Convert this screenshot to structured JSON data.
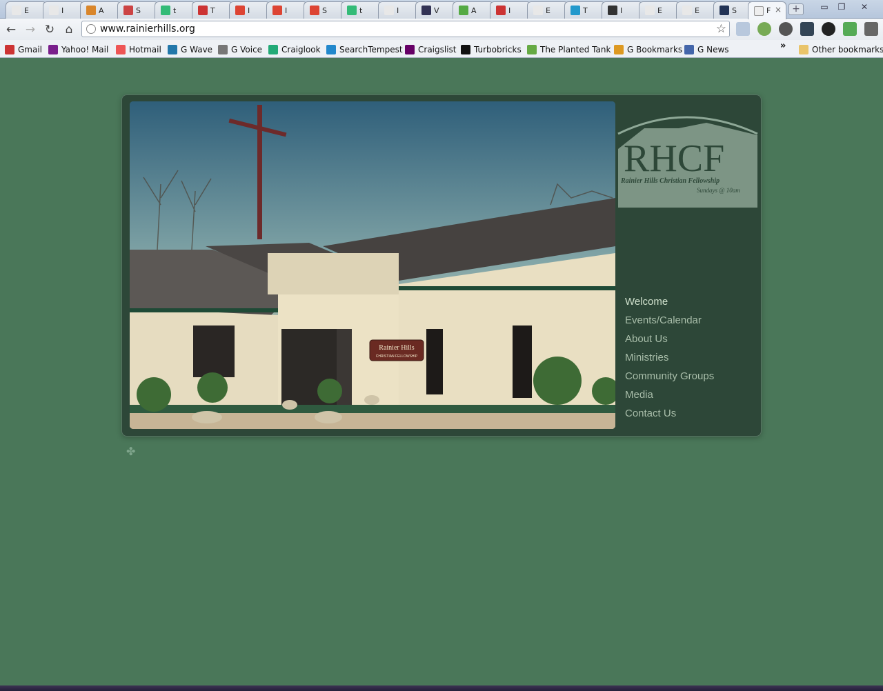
{
  "browser": {
    "tabs": [
      {
        "label": "E",
        "favicon": "page-icon",
        "color": "#e8e8e8"
      },
      {
        "label": "I",
        "favicon": "page-icon",
        "color": "#e8e8e8"
      },
      {
        "label": "A",
        "favicon": "tiger-icon",
        "color": "#d9862b"
      },
      {
        "label": "S",
        "favicon": "chart-icon",
        "color": "#c44"
      },
      {
        "label": "t",
        "favicon": "google-icon",
        "color": "#3b7"
      },
      {
        "label": "T",
        "favicon": "code-icon",
        "color": "#c33"
      },
      {
        "label": "I",
        "favicon": "stack-icon",
        "color": "#d43"
      },
      {
        "label": "I",
        "favicon": "stack-icon",
        "color": "#d43"
      },
      {
        "label": "S",
        "favicon": "stack-icon",
        "color": "#d43"
      },
      {
        "label": "t",
        "favicon": "google-icon",
        "color": "#3b7"
      },
      {
        "label": "I",
        "favicon": "page-icon",
        "color": "#e8e8e8"
      },
      {
        "label": "V",
        "favicon": "globe-icon",
        "color": "#335"
      },
      {
        "label": "A",
        "favicon": "flask-icon",
        "color": "#5a4"
      },
      {
        "label": "I",
        "favicon": "gmail-icon",
        "color": "#c33"
      },
      {
        "label": "E",
        "favicon": "page-icon",
        "color": "#e8e8e8"
      },
      {
        "label": "T",
        "favicon": "tinypic-icon",
        "color": "#29c"
      },
      {
        "label": "I",
        "favicon": "face-icon",
        "color": "#333"
      },
      {
        "label": "E",
        "favicon": "page-icon",
        "color": "#e8e8e8"
      },
      {
        "label": "E",
        "favicon": "page-icon",
        "color": "#e8e8e8"
      },
      {
        "label": "S",
        "favicon": "hg-icon",
        "color": "#235"
      }
    ],
    "active_tab": {
      "label": "F",
      "favicon": "page-icon"
    },
    "close_glyph": "×",
    "new_tab_glyph": "+",
    "window_controls": {
      "minimize": "▭",
      "restore": "❐",
      "close": "✕"
    },
    "nav": {
      "back": "←",
      "forward": "→",
      "reload": "↻",
      "home": "⌂"
    },
    "url": "www.rainierhills.org",
    "star_glyph": "☆",
    "bookmarks": [
      {
        "label": "Gmail",
        "icon": "gmail-icon",
        "color": "#c33"
      },
      {
        "label": "Yahoo! Mail",
        "icon": "yahoo-icon",
        "color": "#7a1f8c"
      },
      {
        "label": "Hotmail",
        "icon": "windows-icon",
        "color": "#e55"
      },
      {
        "label": "G Wave",
        "icon": "wave-icon",
        "color": "#27a"
      },
      {
        "label": "G Voice",
        "icon": "phone-icon",
        "color": "#777"
      },
      {
        "label": "Craiglook",
        "icon": "craiglook-icon",
        "color": "#2a7"
      },
      {
        "label": "SearchTempest",
        "icon": "tempest-icon",
        "color": "#28c"
      },
      {
        "label": "Craigslist",
        "icon": "peace-icon",
        "color": "#606"
      },
      {
        "label": "Turbobricks",
        "icon": "turbo-icon",
        "color": "#111"
      },
      {
        "label": "The Planted Tank",
        "icon": "plant-icon",
        "color": "#6a4"
      },
      {
        "label": "G Bookmarks",
        "icon": "bookmark-star-icon",
        "color": "#d92"
      },
      {
        "label": "G News",
        "icon": "news-icon",
        "color": "#46a"
      }
    ],
    "overflow_glyph": "»",
    "other_bookmarks": "Other bookmarks"
  },
  "site": {
    "logo": {
      "initials": "RHCF",
      "name": "Rainier Hills Christian Fellowship",
      "tagline": "Sundays @ 10am"
    },
    "photo_sign": {
      "title": "Rainier Hills",
      "subtitle": "CHRISTIAN FELLOWSHIP"
    },
    "nav": [
      {
        "label": "Welcome",
        "active": true
      },
      {
        "label": "Events/Calendar",
        "active": false
      },
      {
        "label": "About Us",
        "active": false
      },
      {
        "label": "Ministries",
        "active": false
      },
      {
        "label": "Community Groups",
        "active": false
      },
      {
        "label": "Media",
        "active": false
      },
      {
        "label": "Contact Us",
        "active": false
      }
    ],
    "footer_glyph": "✤"
  },
  "colors": {
    "page_bg": "#4a7759",
    "frame_bg": "#2d4738",
    "nav_text": "#a8bda9"
  }
}
